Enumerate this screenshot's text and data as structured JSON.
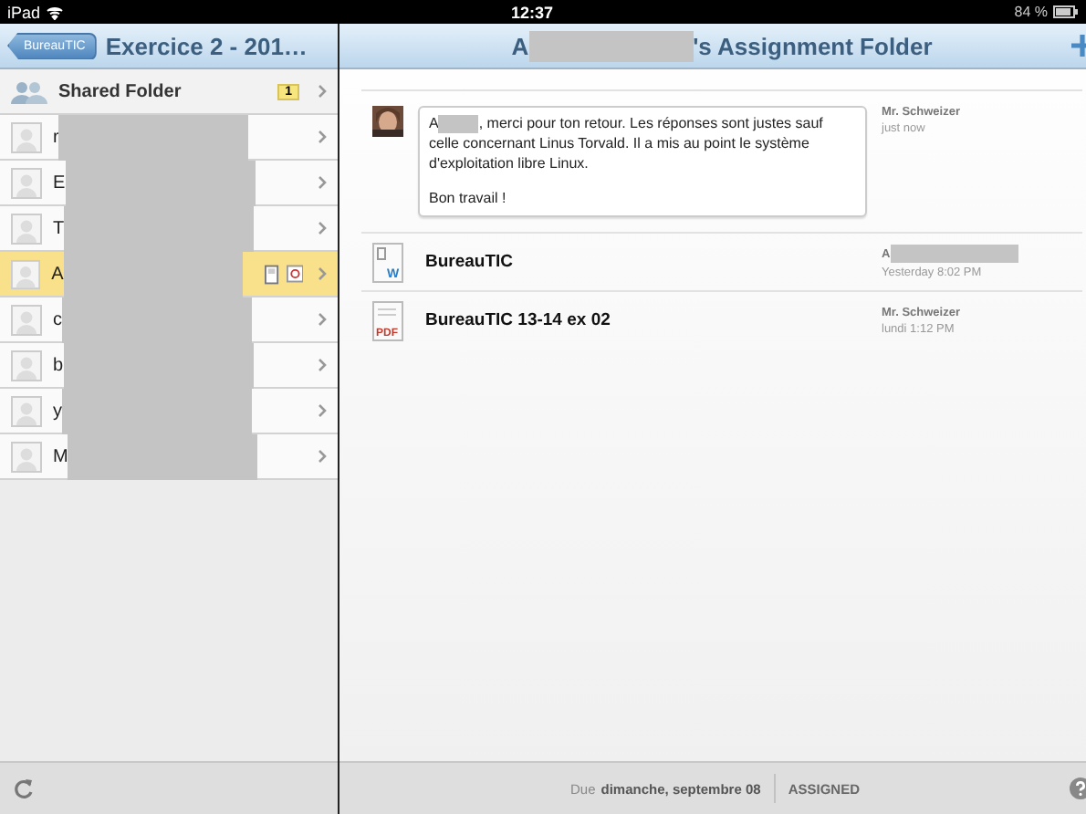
{
  "status_bar": {
    "carrier": "iPad",
    "time": "12:37",
    "battery": "84 %"
  },
  "sidebar": {
    "back": "BureauTIC",
    "title": "Exercice 2 - 201…",
    "shared": {
      "label": "Shared Folder",
      "badge": "1"
    },
    "students": [
      {
        "name": "r",
        "selected": false,
        "has_files": false
      },
      {
        "name": "E",
        "selected": false,
        "has_files": false
      },
      {
        "name": "T",
        "selected": false,
        "has_files": false
      },
      {
        "name": "A",
        "selected": true,
        "has_files": true
      },
      {
        "name": "c",
        "selected": false,
        "has_files": false
      },
      {
        "name": "b",
        "selected": false,
        "has_files": false
      },
      {
        "name": "y",
        "selected": false,
        "has_files": false
      },
      {
        "name": "M",
        "selected": false,
        "has_files": false
      }
    ]
  },
  "folder": {
    "title_start": "A",
    "title_end": "'s Assignment Folder",
    "comment": {
      "start": "A",
      "first_line": ", merci pour ton retour. Les réponses sont justes sauf",
      "text": "celle concernant Linus Torvald. Il a mis au point le système d'exploitation libre Linux.",
      "closing": "Bon travail !",
      "author": "Mr. Schweizer",
      "time": "just now"
    },
    "files": [
      {
        "kind": "word",
        "mark": "W",
        "name": "BureauTIC",
        "author": "A",
        "author_redacted": true,
        "time": "Yesterday 8:02 PM"
      },
      {
        "kind": "pdf",
        "mark": "PDF",
        "name": "BureauTIC 13-14 ex 02",
        "author": "Mr. Schweizer",
        "author_redacted": false,
        "time": "lundi 1:12 PM"
      }
    ]
  },
  "footer": {
    "due_label": "Due",
    "due_date": "dimanche, septembre 08",
    "status": "ASSIGNED"
  }
}
